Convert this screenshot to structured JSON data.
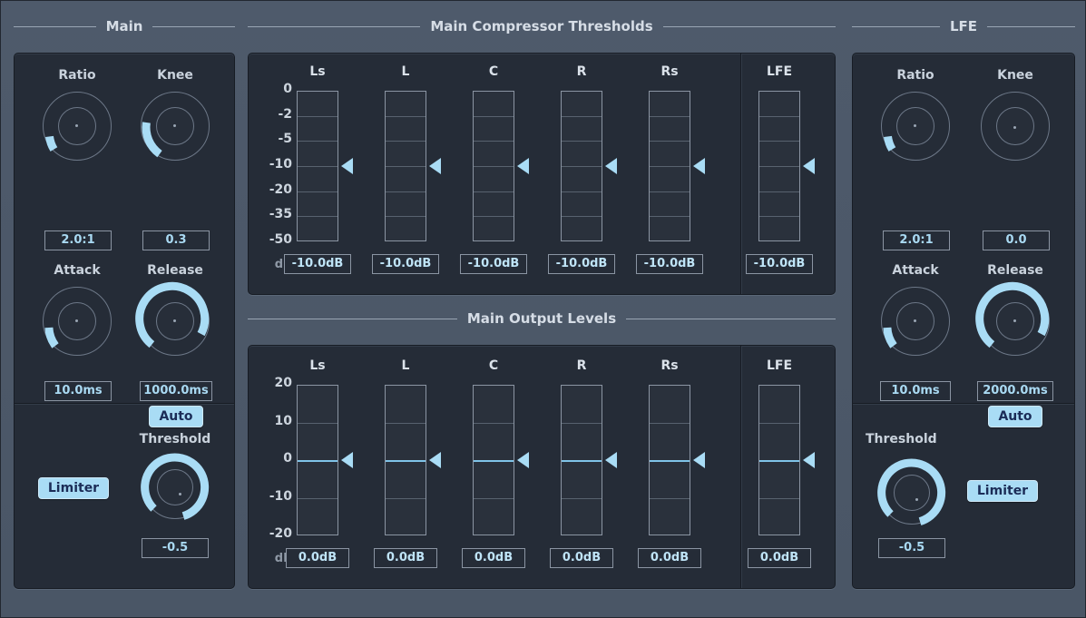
{
  "groups": {
    "main": "Main",
    "compressor": "Main Compressor Thresholds",
    "output": "Main Output Levels",
    "lfe": "LFE"
  },
  "main_panel": {
    "ratio": {
      "label": "Ratio",
      "value": "2.0:1"
    },
    "knee": {
      "label": "Knee",
      "value": "0.3"
    },
    "attack": {
      "label": "Attack",
      "value": "10.0ms"
    },
    "release": {
      "label": "Release",
      "value": "1000.0ms"
    },
    "auto": {
      "label": "Auto"
    },
    "limiter": {
      "label": "Limiter"
    },
    "threshold": {
      "label": "Threshold",
      "value": "-0.5"
    }
  },
  "lfe_panel": {
    "ratio": {
      "label": "Ratio",
      "value": "2.0:1"
    },
    "knee": {
      "label": "Knee",
      "value": "0.0"
    },
    "attack": {
      "label": "Attack",
      "value": "10.0ms"
    },
    "release": {
      "label": "Release",
      "value": "2000.0ms"
    },
    "auto": {
      "label": "Auto"
    },
    "limiter": {
      "label": "Limiter"
    },
    "threshold": {
      "label": "Threshold",
      "value": "-0.5"
    }
  },
  "compressor_meters": {
    "unit": "dB",
    "axis_labels": [
      "0",
      "-2",
      "-5",
      "-10",
      "-20",
      "-35",
      "-50"
    ],
    "channels": [
      {
        "name": "Ls",
        "value": "-10.0dB"
      },
      {
        "name": "L",
        "value": "-10.0dB"
      },
      {
        "name": "C",
        "value": "-10.0dB"
      },
      {
        "name": "R",
        "value": "-10.0dB"
      },
      {
        "name": "Rs",
        "value": "-10.0dB"
      },
      {
        "name": "LFE",
        "value": "-10.0dB"
      }
    ]
  },
  "output_meters": {
    "unit": "dB",
    "axis_labels": [
      "20",
      "10",
      "0",
      "-10",
      "-20"
    ],
    "channels": [
      {
        "name": "Ls",
        "value": "0.0dB"
      },
      {
        "name": "L",
        "value": "0.0dB"
      },
      {
        "name": "C",
        "value": "0.0dB"
      },
      {
        "name": "R",
        "value": "0.0dB"
      },
      {
        "name": "Rs",
        "value": "0.0dB"
      },
      {
        "name": "LFE",
        "value": "0.0dB"
      }
    ]
  },
  "colors": {
    "accent": "#a9dcf5",
    "panel": "#252c37",
    "background": "#4a5666",
    "text": "#d6dde6"
  }
}
